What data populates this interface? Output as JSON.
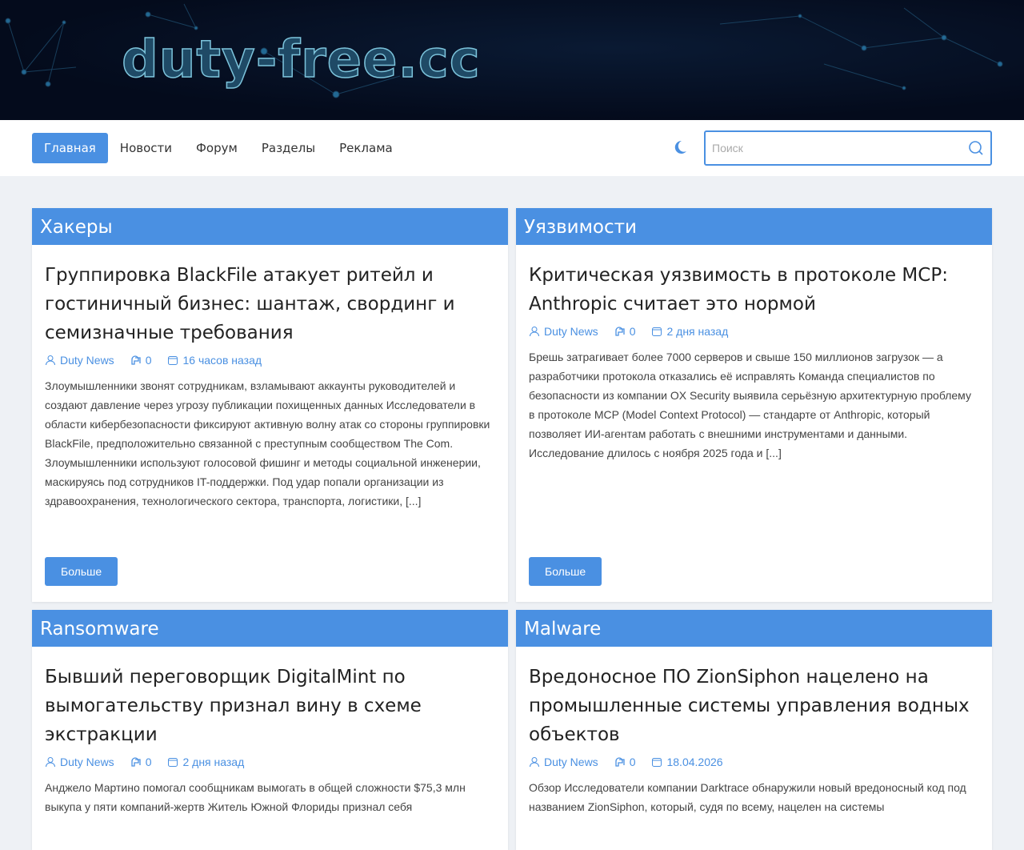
{
  "site": {
    "logo": "duty-free.cc"
  },
  "nav": {
    "items": [
      "Главная",
      "Новости",
      "Форум",
      "Разделы",
      "Реклама"
    ],
    "active": 0,
    "search_placeholder": "Поиск"
  },
  "colors": {
    "accent": "#4a90e2",
    "banner": "#040b1c"
  },
  "cards": [
    {
      "category": "Хакеры",
      "title": "Группировка BlackFile атакует ритейл и гостиничный бизнес: шантаж, свординг и семизначные требования",
      "author": "Duty News",
      "comments": "0",
      "date": "16 часов назад",
      "excerpt": "Злоумышленники звонят сотрудникам, взламывают аккаунты руководителей и создают давление через угрозу публикации похищенных данных Исследователи в области кибербезопасности фиксируют активную волну атак со стороны группировки BlackFile, предположительно связанной с преступным сообществом The Com. Злоумышленники используют голосовой фишинг и методы социальной инженерии, маскируясь под сотрудников IT-поддержки. Под удар попали организации из здравоохранения, технологического сектора, транспорта, логистики, [...]",
      "more": "Больше"
    },
    {
      "category": "Уязвимости",
      "title": "Критическая уязвимость в протоколе MCP: Anthropic считает это нормой",
      "author": "Duty News",
      "comments": "0",
      "date": "2 дня назад",
      "excerpt": "Брешь затрагивает более 7000 серверов и свыше 150 миллионов загрузок — а разработчики протокола отказались её исправлять Команда специалистов по безопасности из компании OX Security выявила серьёзную архитектурную проблему в протоколе MCP (Model Context Protocol) — стандарте от Anthropic, который позволяет ИИ-агентам работать с внешними инструментами и данными. Исследование длилось с ноября 2025 года и [...]",
      "more": "Больше"
    },
    {
      "category": "Ransomware",
      "title": "Бывший переговорщик DigitalMint по вымогательству признал вину в схеме экстракции",
      "author": "Duty News",
      "comments": "0",
      "date": "2 дня назад",
      "excerpt": "Анджело Мартино помогал сообщникам вымогать в общей сложности $75,3 млн выкупа у пяти компаний-жертв Житель Южной Флориды признал себя"
    },
    {
      "category": "Malware",
      "title": "Вредоносное ПО ZionSiphon нацелено на промышленные системы управления водных объектов",
      "author": "Duty News",
      "comments": "0",
      "date": "18.04.2026",
      "excerpt": "Обзор Исследователи компании Darktrace обнаружили новый вредоносный код под названием ZionSiphon, который, судя по всему, нацелен на системы"
    }
  ]
}
